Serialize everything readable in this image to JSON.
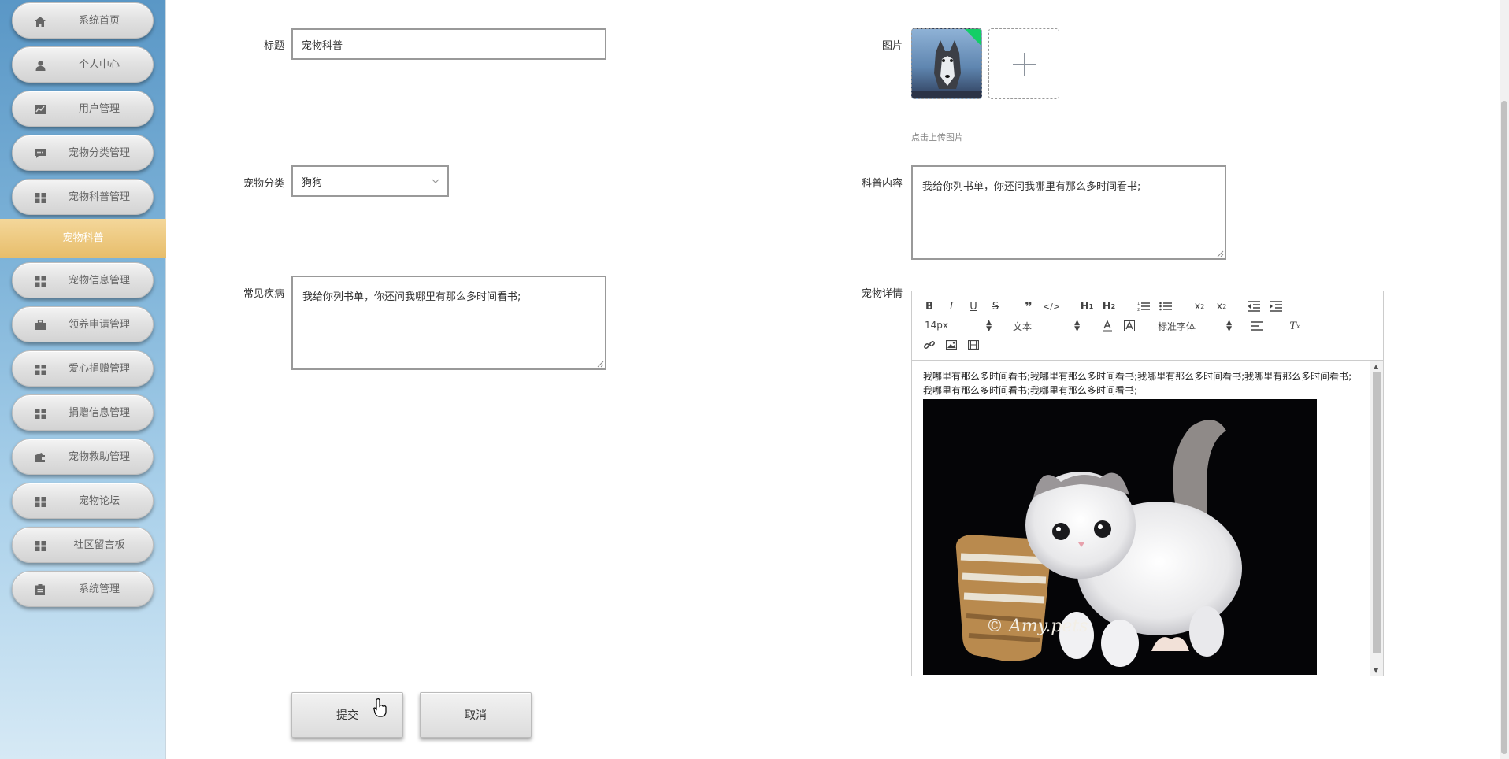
{
  "sidebar": {
    "items": [
      {
        "label": "系统首页",
        "icon": "home-icon"
      },
      {
        "label": "个人中心",
        "icon": "user-icon"
      },
      {
        "label": "用户管理",
        "icon": "chart-icon"
      },
      {
        "label": "宠物分类管理",
        "icon": "comment-icon"
      },
      {
        "label": "宠物科普管理",
        "icon": "grid-icon"
      },
      {
        "label": "宠物信息管理",
        "icon": "grid-icon"
      },
      {
        "label": "领养申请管理",
        "icon": "briefcase-icon"
      },
      {
        "label": "爱心捐赠管理",
        "icon": "grid-icon"
      },
      {
        "label": "捐赠信息管理",
        "icon": "grid-icon"
      },
      {
        "label": "宠物救助管理",
        "icon": "wallet-icon"
      },
      {
        "label": "宠物论坛",
        "icon": "grid-icon"
      },
      {
        "label": "社区留言板",
        "icon": "grid-icon"
      },
      {
        "label": "系统管理",
        "icon": "clipboard-icon"
      }
    ],
    "active_sub": "宠物科普"
  },
  "form": {
    "title_label": "标题",
    "title_value": "宠物科普",
    "image_label": "图片",
    "upload_hint": "点击上传图片",
    "category_label": "宠物分类",
    "category_value": "狗狗",
    "science_label": "科普内容",
    "science_value": "我给你列书单，你还问我哪里有那么多时间看书;",
    "disease_label": "常见疾病",
    "disease_value": "我给你列书单，你还问我哪里有那么多时间看书;",
    "detail_label": "宠物详情",
    "submit_label": "提交",
    "cancel_label": "取消"
  },
  "editor": {
    "font_size": "14px",
    "block_type": "文本",
    "font_family": "标准字体",
    "content_text": "我哪里有那么多时间看书;我哪里有那么多时间看书;我哪里有那么多时间看书;我哪里有那么多时间看书;我哪里有那么多时间看书;我哪里有那么多时间看书;",
    "image_watermark": "© Amy.pets"
  },
  "colors": {
    "sidebar_top": "#5a97c6",
    "sidebar_active": "#e7bd6a",
    "border": "#999999"
  }
}
